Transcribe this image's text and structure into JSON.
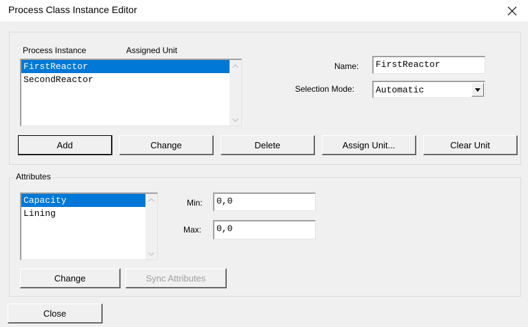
{
  "window": {
    "title": "Process Class Instance Editor",
    "close_icon": "close-icon"
  },
  "process": {
    "header_instance": "Process Instance",
    "header_unit": "Assigned Unit",
    "items": [
      "FirstReactor",
      "SecondReactor"
    ],
    "selected_index": 0,
    "name_label": "Name:",
    "name_value": "FirstReactor",
    "mode_label": "Selection Mode:",
    "mode_value": "Automatic",
    "buttons": {
      "add": "Add",
      "change": "Change",
      "delete": "Delete",
      "assign_unit": "Assign Unit...",
      "clear_unit": "Clear Unit"
    }
  },
  "attributes": {
    "legend": "Attributes",
    "items": [
      "Capacity",
      "Lining"
    ],
    "selected_index": 0,
    "min_label": "Min:",
    "min_value": "0,0",
    "max_label": "Max:",
    "max_value": "0,0",
    "change_label": "Change",
    "sync_label": "Sync Attributes"
  },
  "close_label": "Close",
  "colors": {
    "selection": "#0078d7",
    "window_bg": "#f0f0f0"
  }
}
